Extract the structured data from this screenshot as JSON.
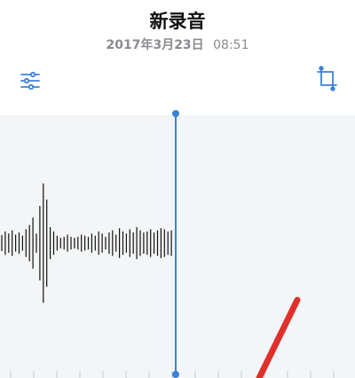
{
  "recording": {
    "title": "新录音",
    "date": "2017年3月23日",
    "time": "08:51"
  },
  "icons": {
    "settings": "sliders-icon",
    "crop": "crop-trim-icon"
  },
  "playhead": {
    "position_fraction": 0.49
  },
  "colors": {
    "accent": "#3b82d6",
    "waveform": "#111111",
    "wave_background": "#f3f6f8",
    "annotation": "#e0302a"
  }
}
